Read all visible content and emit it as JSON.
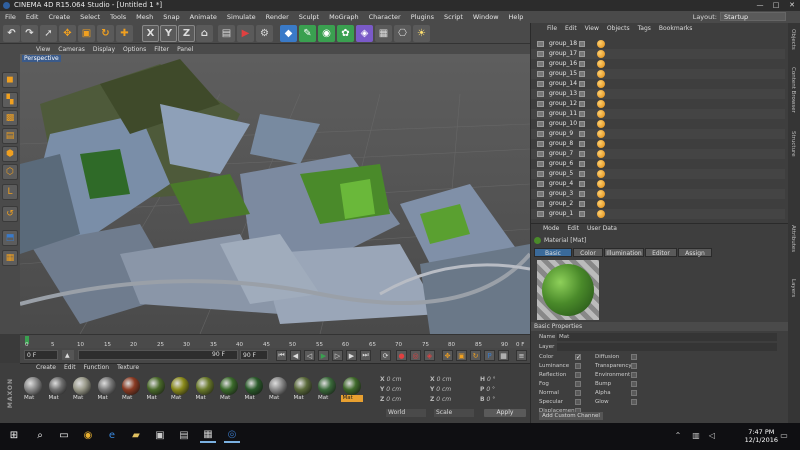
{
  "app": {
    "title": "CINEMA 4D R15.064 Studio - [Untitled 1 *]",
    "window_controls": [
      "—",
      "□",
      "✕"
    ]
  },
  "menubar": {
    "items": [
      "File",
      "Edit",
      "Create",
      "Select",
      "Tools",
      "Mesh",
      "Snap",
      "Animate",
      "Simulate",
      "Render",
      "Sculpt",
      "MoGraph",
      "Character",
      "Plugins",
      "Script",
      "Window",
      "Help"
    ]
  },
  "layout": {
    "label": "Layout:",
    "value": "Startup"
  },
  "viewport": {
    "menu": [
      "View",
      "Cameras",
      "Display",
      "Options",
      "Filter",
      "Panel"
    ],
    "label": "Perspective"
  },
  "timeline": {
    "ticks": [
      "0",
      "5",
      "10",
      "15",
      "20",
      "25",
      "30",
      "35",
      "40",
      "45",
      "50",
      "55",
      "60",
      "65",
      "70",
      "75",
      "80",
      "85",
      "90"
    ],
    "end_label": "0 F"
  },
  "transport": {
    "start": "0 F",
    "current": "0 F",
    "end": "90 F",
    "preview_end": "90 F"
  },
  "material_manager": {
    "menu": [
      "Create",
      "Edit",
      "Function",
      "Texture"
    ],
    "materials": [
      {
        "label": "Mat",
        "color": "#8a8a8a"
      },
      {
        "label": "Mat",
        "color": "#6f6f6f"
      },
      {
        "label": "Mat",
        "color": "#9a9a8a"
      },
      {
        "label": "Mat",
        "color": "#7a7a7a"
      },
      {
        "label": "Mat",
        "color": "#8a3a22"
      },
      {
        "label": "Mat",
        "color": "#4a6a2a"
      },
      {
        "label": "Mat",
        "color": "#8a8a1a"
      },
      {
        "label": "Mat",
        "color": "#6a7a2a"
      },
      {
        "label": "Mat",
        "color": "#3a6a2a"
      },
      {
        "label": "Mat",
        "color": "#2a5a2a"
      },
      {
        "label": "Mat",
        "color": "#8a8a8a"
      },
      {
        "label": "Mat",
        "color": "#5a6a3a"
      },
      {
        "label": "Mat",
        "color": "#3a6a3a"
      },
      {
        "label": "Mat",
        "color": "#3f6a2a",
        "selected": true
      }
    ]
  },
  "coordinates": {
    "rows": [
      {
        "a": "X",
        "av": "0 cm",
        "b": "X",
        "bv": "0 cm",
        "c": "H",
        "cv": "0 °"
      },
      {
        "a": "Y",
        "av": "0 cm",
        "b": "Y",
        "bv": "0 cm",
        "c": "P",
        "cv": "0 °"
      },
      {
        "a": "Z",
        "av": "0 cm",
        "b": "Z",
        "bv": "0 cm",
        "c": "B",
        "cv": "0 °"
      }
    ],
    "mode1": "World",
    "mode2": "Scale",
    "apply": "Apply"
  },
  "object_manager": {
    "menu": [
      "File",
      "Edit",
      "View",
      "Objects",
      "Tags",
      "Bookmarks"
    ],
    "objects": [
      "group_18",
      "group_17",
      "group_16",
      "group_15",
      "group_14",
      "group_13",
      "group_12",
      "group_11",
      "group_10",
      "group_9",
      "group_8",
      "group_7",
      "group_6",
      "group_5",
      "group_4",
      "group_3",
      "group_2",
      "group_1"
    ]
  },
  "attribute_manager": {
    "menu": [
      "Mode",
      "Edit",
      "User Data"
    ],
    "header": "Material [Mat]",
    "tabs": [
      "Basic",
      "Color",
      "Illumination",
      "Editor",
      "Assign"
    ],
    "section": "Basic Properties",
    "name_label": "Name",
    "name_value": "Mat",
    "layer_label": "Layer",
    "left_props": [
      "Color",
      "Luminance",
      "Reflection",
      "Fog",
      "Normal",
      "Specular",
      "Displacement"
    ],
    "left_checked": [
      true,
      false,
      false,
      false,
      false,
      false,
      false
    ],
    "right_props": [
      "Diffusion",
      "Transparency",
      "Environment",
      "Bump",
      "Alpha",
      "Glow"
    ],
    "custom_channel": "Add Custom Channel"
  },
  "side_tabs": [
    "Objects",
    "Content Browser",
    "Structure",
    "Attributes",
    "Layers"
  ],
  "taskbar": {
    "time": "7:47 PM",
    "date": "12/1/2016"
  }
}
